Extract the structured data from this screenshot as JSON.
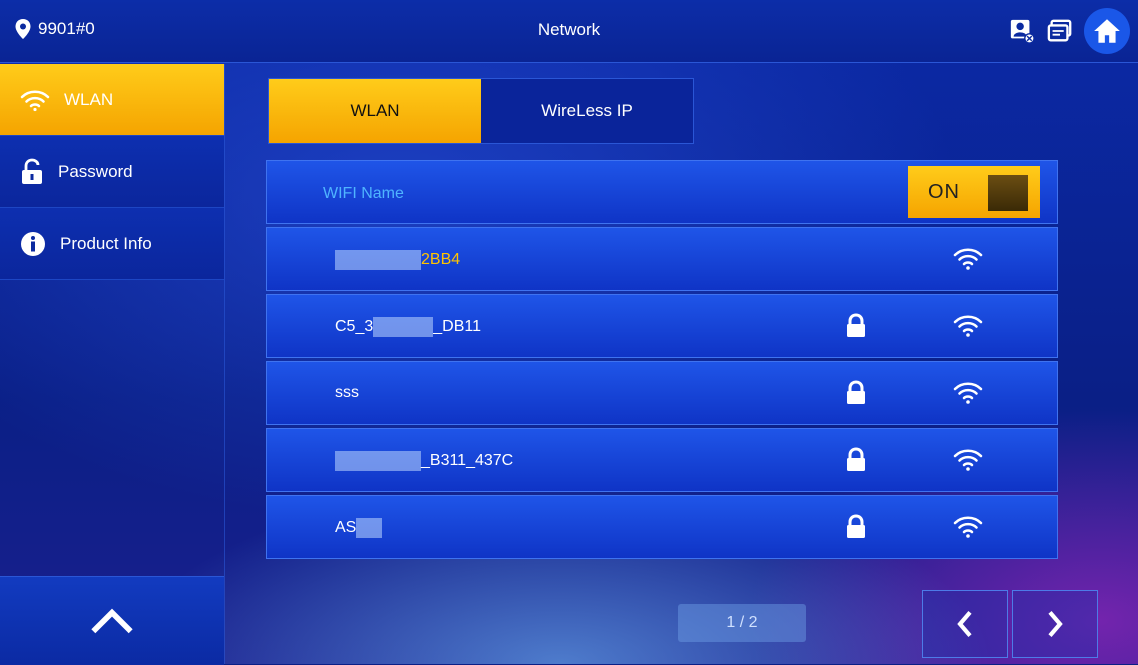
{
  "header": {
    "location": "9901#0",
    "title": "Network"
  },
  "sidebar": {
    "items": [
      {
        "label": "WLAN",
        "active": true
      },
      {
        "label": "Password",
        "active": false
      },
      {
        "label": "Product Info",
        "active": false
      }
    ]
  },
  "tabs": [
    {
      "label": "WLAN",
      "active": true
    },
    {
      "label": "WireLess IP",
      "active": false
    }
  ],
  "wifi": {
    "header_label": "WIFI Name",
    "toggle_label": "ON",
    "networks": [
      {
        "visible_suffix": "2BB4",
        "locked": false
      },
      {
        "visible_prefix": "C5_3",
        "visible_suffix": "_DB11",
        "locked": true
      },
      {
        "name": "sss",
        "locked": true
      },
      {
        "visible_suffix": "_B311_437C",
        "locked": true
      },
      {
        "visible_prefix": "AS",
        "locked": true
      }
    ]
  },
  "pager": {
    "text": "1 / 2"
  },
  "colors": {
    "accent": "#f5a400",
    "bg": "#0a1f86",
    "active_text": "#ffc400"
  }
}
